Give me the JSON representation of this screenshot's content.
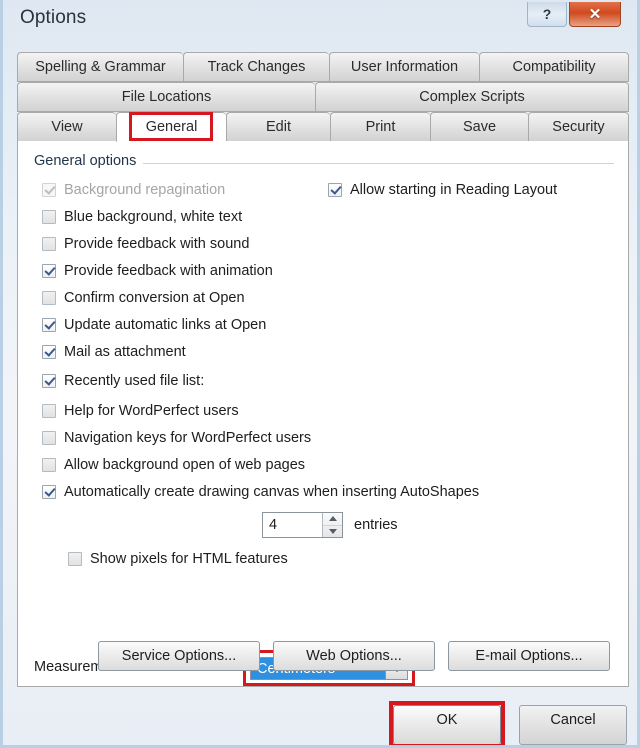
{
  "window": {
    "title": "Options",
    "help_button": "?",
    "close_button": "✕"
  },
  "tabs": {
    "row1": [
      {
        "label": "Spelling & Grammar",
        "active": false
      },
      {
        "label": "Track Changes",
        "active": false
      },
      {
        "label": "User Information",
        "active": false
      },
      {
        "label": "Compatibility",
        "active": false
      }
    ],
    "row2": [
      {
        "label": "File Locations",
        "active": false
      },
      {
        "label": "Complex Scripts",
        "active": false
      }
    ],
    "row3": [
      {
        "label": "View",
        "active": false
      },
      {
        "label": "General",
        "active": true
      },
      {
        "label": "Edit",
        "active": false
      },
      {
        "label": "Print",
        "active": false
      },
      {
        "label": "Save",
        "active": false
      },
      {
        "label": "Security",
        "active": false
      }
    ]
  },
  "panel": {
    "group_label": "General options",
    "checkboxes_left": [
      {
        "label": "Background repagination",
        "checked": true,
        "disabled": true
      },
      {
        "label": "Blue background, white text",
        "checked": false,
        "disabled": false
      },
      {
        "label": "Provide feedback with sound",
        "checked": false,
        "disabled": false
      },
      {
        "label": "Provide feedback with animation",
        "checked": true,
        "disabled": false
      },
      {
        "label": "Confirm conversion at Open",
        "checked": false,
        "disabled": false
      },
      {
        "label": "Update automatic links at Open",
        "checked": true,
        "disabled": false
      },
      {
        "label": "Mail as attachment",
        "checked": true,
        "disabled": false
      },
      {
        "label": "Recently used file list:",
        "checked": true,
        "disabled": false
      },
      {
        "label": "Help for WordPerfect users",
        "checked": false,
        "disabled": false
      },
      {
        "label": "Navigation keys for WordPerfect users",
        "checked": false,
        "disabled": false
      },
      {
        "label": "Allow background open of web pages",
        "checked": false,
        "disabled": false
      },
      {
        "label": "Automatically create drawing canvas when inserting AutoShapes",
        "checked": true,
        "disabled": false
      }
    ],
    "checkbox_right": {
      "label": "Allow starting in Reading Layout",
      "checked": true
    },
    "recent_files": {
      "value": "4",
      "units_label": "entries"
    },
    "measurement": {
      "label": "Measurement units:",
      "selected": "Centimeters",
      "dropdown_icon": "chevron-down-icon"
    },
    "show_pixels": {
      "label": "Show pixels for HTML features",
      "checked": false
    },
    "buttons": [
      {
        "label": "Service Options..."
      },
      {
        "label": "Web Options..."
      },
      {
        "label": "E-mail Options..."
      }
    ]
  },
  "footer": {
    "ok_label": "OK",
    "cancel_label": "Cancel"
  },
  "colors": {
    "highlight_red": "#d4181e",
    "selection_blue": "#2f8fe0",
    "close_orange": "#cf4a1e"
  }
}
